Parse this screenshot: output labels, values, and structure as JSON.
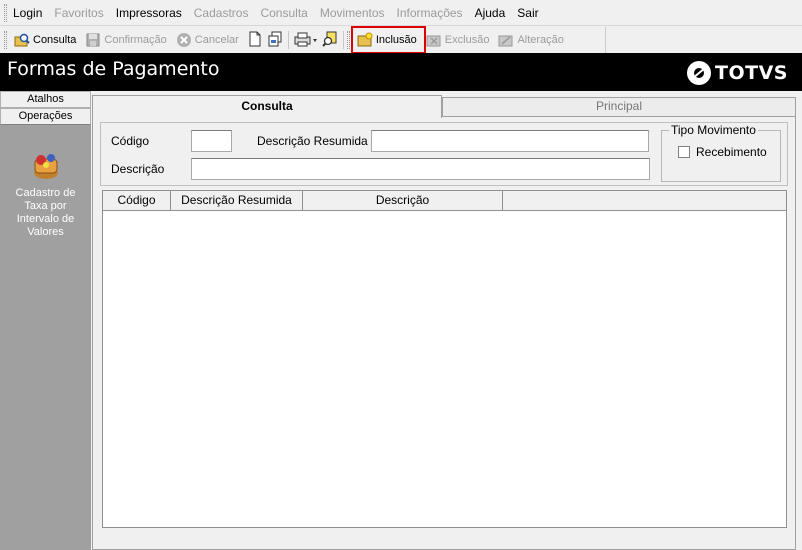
{
  "menu": {
    "items": [
      {
        "label": "Login",
        "disabled": false
      },
      {
        "label": "Favoritos",
        "disabled": true
      },
      {
        "label": "Impressoras",
        "disabled": false
      },
      {
        "label": "Cadastros",
        "disabled": true
      },
      {
        "label": "Consulta",
        "disabled": true
      },
      {
        "label": "Movimentos",
        "disabled": true
      },
      {
        "label": "Informações",
        "disabled": true
      },
      {
        "label": "Ajuda",
        "disabled": false
      },
      {
        "label": "Sair",
        "disabled": false
      }
    ]
  },
  "toolbar": {
    "consulta": "Consulta",
    "confirmacao": "Confirmação",
    "cancelar": "Cancelar",
    "inclusao": "Inclusão",
    "exclusao": "Exclusão",
    "alteracao": "Alteração"
  },
  "window": {
    "title": "Formas de Pagamento",
    "brand": "TOTVS"
  },
  "sidebar": {
    "tab_atalhos": "Atalhos",
    "tab_operacoes": "Operações",
    "item_label_1": "Cadastro de",
    "item_label_2": "Taxa por",
    "item_label_3": "Intervalo de",
    "item_label_4": "Valores"
  },
  "tabs": {
    "consulta": "Consulta",
    "principal": "Principal"
  },
  "form": {
    "codigo_label": "Código",
    "descricao_resumida_label": "Descrição Resumida",
    "descricao_label": "Descrição",
    "tipo_movimento_label": "Tipo Movimento",
    "recebimento_label": "Recebimento"
  },
  "grid": {
    "columns": [
      "Código",
      "Descrição Resumida",
      "Descrição"
    ]
  },
  "colors": {
    "titlebar": "#000000",
    "sidebar": "#a0a0a0",
    "highlight": "#e00000"
  }
}
